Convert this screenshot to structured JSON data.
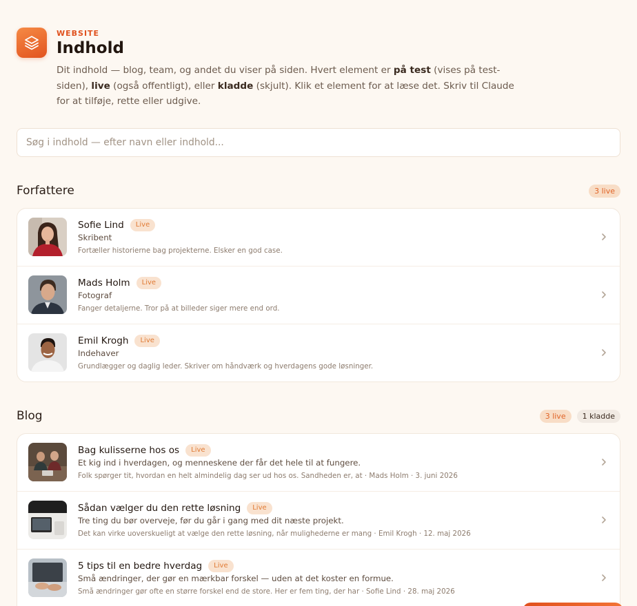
{
  "header": {
    "eyebrow": "WEBSITE",
    "title": "Indhold",
    "desc_1": "Dit indhold — blog, team, og andet du viser på siden. Hvert element er ",
    "desc_b1": "på test",
    "desc_2": " (vises på test-siden), ",
    "desc_b2": "live",
    "desc_3": " (også offentligt), eller ",
    "desc_b3": "kladde",
    "desc_4": " (skjult). Klik et element for at læse det. Skriv til Claude for at tilføje, rette eller udgive."
  },
  "search": {
    "placeholder": "Søg i indhold — efter navn eller indhold..."
  },
  "authors": {
    "title": "Forfattere",
    "live_badge": "3 live",
    "items": [
      {
        "name": "Sofie Lind",
        "status": "Live",
        "role": "Skribent",
        "bio": "Fortæller historierne bag projekterne. Elsker en god case."
      },
      {
        "name": "Mads Holm",
        "status": "Live",
        "role": "Fotograf",
        "bio": "Fanger detaljerne. Tror på at billeder siger mere end ord."
      },
      {
        "name": "Emil Krogh",
        "status": "Live",
        "role": "Indehaver",
        "bio": "Grundlægger og daglig leder. Skriver om håndværk og hverdagens gode løsninger."
      }
    ]
  },
  "blog": {
    "title": "Blog",
    "live_badge": "3 live",
    "draft_badge": "1 kladde",
    "items": [
      {
        "title": "Bag kulisserne hos os",
        "status": "Live",
        "subtitle": "Et kig ind i hverdagen, og menneskene der får det hele til at fungere.",
        "meta": "Folk spørger tit, hvordan en helt almindelig dag ser ud hos os. Sandheden er, at · Mads Holm · 3. juni 2026"
      },
      {
        "title": "Sådan vælger du den rette løsning",
        "status": "Live",
        "subtitle": "Tre ting du bør overveje, før du går i gang med dit næste projekt.",
        "meta": "Det kan virke uoverskueligt at vælge den rette løsning, når mulighederne er mang · Emil Krogh · 12. maj 2026"
      },
      {
        "title": "5 tips til en bedre hverdag",
        "status": "Live",
        "subtitle": "Små ændringer, der gør en mærkbar forskel — uden at det koster en formue.",
        "meta": "Små ændringer gør ofte en større forskel end de store. Her er fem ting, der har · Sofie Lind · 28. maj 2026"
      }
    ]
  },
  "colors": {
    "accent": "#e2531f",
    "live_pill_bg": "#f9e2cf",
    "page_bg": "#fdf8f2"
  },
  "icons": {
    "app": "layers-icon",
    "row_arrow": "chevron-right-icon"
  }
}
